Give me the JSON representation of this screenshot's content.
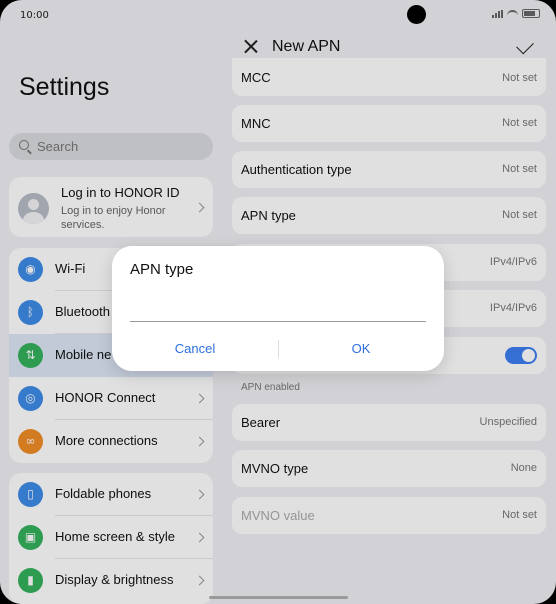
{
  "status_bar": {
    "time": "10:00"
  },
  "left": {
    "title": "Settings",
    "search_placeholder": "Search",
    "account": {
      "name": "Log in to HONOR ID",
      "subtitle": "Log in to enjoy Honor services."
    },
    "group1": [
      {
        "label": "Wi-Fi",
        "icon": "wifi-icon",
        "color": "#3d8be8",
        "glyph": "◉"
      },
      {
        "label": "Bluetooth",
        "icon": "bluetooth-icon",
        "color": "#3d8be8",
        "glyph": "ᛒ"
      },
      {
        "label": "Mobile ne",
        "icon": "mobile-network-icon",
        "color": "#34b15c",
        "glyph": "⇅"
      },
      {
        "label": "HONOR Connect",
        "icon": "honor-connect-icon",
        "color": "#3d8be8",
        "glyph": "◎"
      },
      {
        "label": "More connections",
        "icon": "link-icon",
        "color": "#f08c26",
        "glyph": "∞"
      }
    ],
    "group2": [
      {
        "label": "Foldable phones",
        "icon": "foldable-icon",
        "color": "#3d8be8",
        "glyph": "▯"
      },
      {
        "label": "Home screen & style",
        "icon": "home-screen-icon",
        "color": "#34b15c",
        "glyph": "▣"
      },
      {
        "label": "Display & brightness",
        "icon": "display-icon",
        "color": "#34b15c",
        "glyph": "▮"
      }
    ]
  },
  "right": {
    "title": "New APN",
    "items": [
      {
        "key": "MCC",
        "value": "Not set"
      },
      {
        "key": "MNC",
        "value": "Not set"
      },
      {
        "key": "Authentication type",
        "value": "Not set"
      },
      {
        "key": "APN type",
        "value": "Not set"
      },
      {
        "key": "",
        "value": "IPv4/IPv6"
      },
      {
        "key": "",
        "value": "IPv4/IPv6"
      }
    ],
    "apn_enabled_label": "APN enabled",
    "items2": [
      {
        "key": "Bearer",
        "value": "Unspecified"
      },
      {
        "key": "MVNO type",
        "value": "None"
      },
      {
        "key": "MVNO value",
        "value": "Not set"
      }
    ]
  },
  "dialog": {
    "title": "APN type",
    "value": "",
    "cancel": "Cancel",
    "ok": "OK"
  },
  "colors": {
    "accent": "#2f6fdc",
    "toggle_on": "#3d7ff2"
  }
}
